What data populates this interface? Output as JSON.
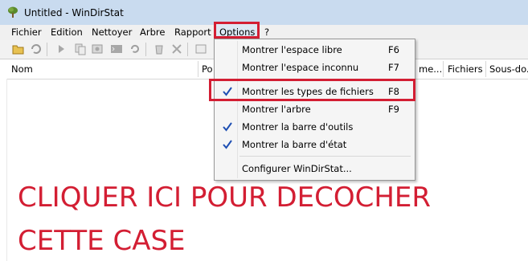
{
  "window": {
    "title": "Untitled - WinDirStat"
  },
  "menubar": {
    "items": [
      "Fichier",
      "Edition",
      "Nettoyer",
      "Arbre",
      "Rapport",
      "Options",
      "?"
    ]
  },
  "columns": {
    "name": "Nom",
    "partial": "Po",
    "partial_middle": "me...",
    "files": "Fichiers",
    "subdirs": "Sous-do..."
  },
  "options_menu": {
    "items": [
      {
        "label": "Montrer l'espace libre",
        "shortcut": "F6",
        "checked": false
      },
      {
        "label": "Montrer l'espace inconnu",
        "shortcut": "F7",
        "checked": false
      },
      {
        "label": "Montrer les types de fichiers",
        "shortcut": "F8",
        "checked": true
      },
      {
        "label": "Montrer l'arbre",
        "shortcut": "F9",
        "checked": false
      },
      {
        "label": "Montrer la barre d'outils",
        "shortcut": "",
        "checked": true
      },
      {
        "label": "Montrer la barre d'état",
        "shortcut": "",
        "checked": true
      },
      {
        "label": "Configurer WinDirStat...",
        "shortcut": "",
        "checked": false
      }
    ]
  },
  "annotation": {
    "line1": "CLIQUER ICI POUR DECOCHER",
    "line2": "CETTE CASE"
  },
  "colors": {
    "accent_red": "#d31e33",
    "check_blue": "#1e4fb3",
    "titlebar": "#c9dbef"
  }
}
